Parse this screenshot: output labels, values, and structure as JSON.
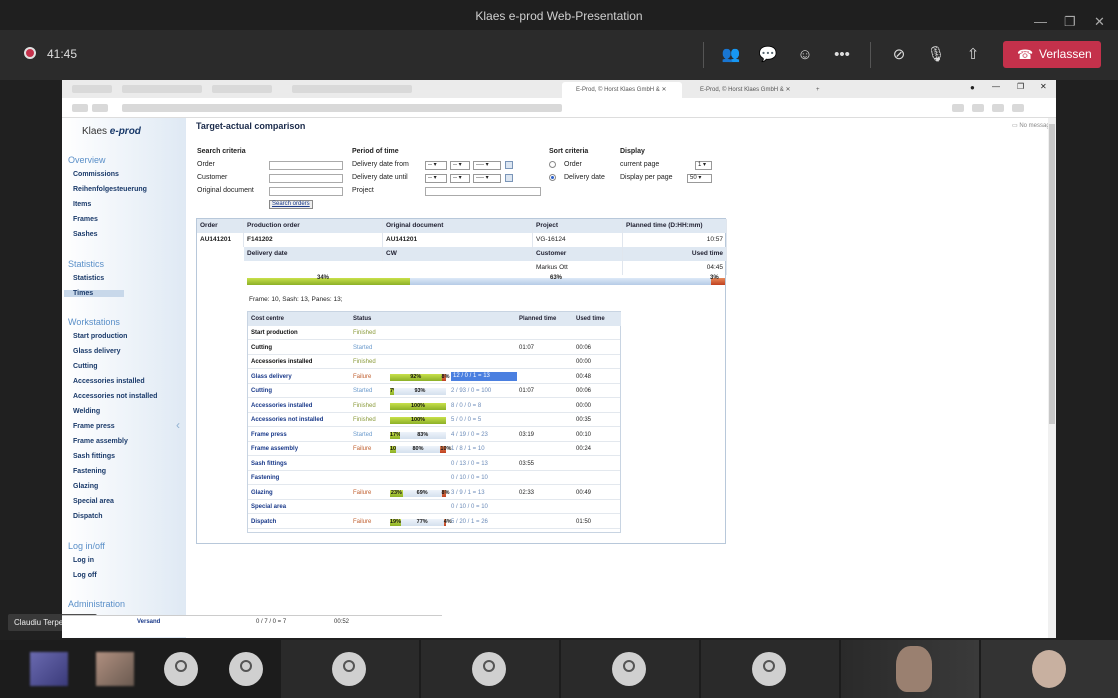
{
  "window": {
    "title": "Klaes e-prod Web-Presentation"
  },
  "meeting": {
    "timer": "41:45",
    "leave_label": "Verlassen",
    "presenter_name": "Claudiu Terpeziceanu"
  },
  "browser": {
    "tabs": [
      "E-Prod, © Horst Klaes GmbH &",
      "E-Prod, © Horst Klaes GmbH &"
    ]
  },
  "sidebar": {
    "logo_text": "Klaes",
    "logo_brand": "e-prod",
    "overview": {
      "title": "Overview",
      "items": [
        "Commissions",
        "Reihenfolgesteuerung",
        "Items",
        "Frames",
        "Sashes"
      ]
    },
    "statistics": {
      "title": "Statistics",
      "items": [
        "Statistics",
        "Times"
      ]
    },
    "workstations": {
      "title": "Workstations",
      "items": [
        "Start production",
        "Glass delivery",
        "Cutting",
        "Accessories installed",
        "Accessories not installed",
        "Welding",
        "Frame press",
        "Frame assembly",
        "Sash fittings",
        "Fastening",
        "Glazing",
        "Special area",
        "Dispatch"
      ]
    },
    "login": {
      "title": "Log in/off",
      "items": [
        "Log in",
        "Log off"
      ]
    },
    "admin": {
      "title": "Administration"
    }
  },
  "page": {
    "title": "Target-actual comparison",
    "messages": "No messages"
  },
  "search": {
    "criteria_title": "Search criteria",
    "order": "Order",
    "customer": "Customer",
    "original_document": "Original document",
    "button": "Search orders",
    "period_title": "Period of time",
    "from": "Delivery date from",
    "until": "Delivery date until",
    "project": "Project",
    "dd": "--",
    "dddd": "----",
    "sort_title": "Sort criteria",
    "sort_order": "Order",
    "sort_delivery": "Delivery date",
    "display_title": "Display",
    "current_page": "current page",
    "per_page": "Display per page",
    "current_page_val": "1",
    "per_page_val": "50"
  },
  "order_info": {
    "headers": [
      "Order",
      "Production order",
      "Original document",
      "Project",
      "Planned time (D:HH:mm)"
    ],
    "order": "AU141201",
    "production_order": "F141202",
    "original_document": "AU141201",
    "project": "VG-16124",
    "planned_time": "10:57",
    "headers2": [
      "Delivery date",
      "CW",
      "Customer",
      "Used time"
    ],
    "customer": "Markus Ott",
    "used_time": "04:45",
    "progress": {
      "green_pct": 34,
      "blue_pct": 63,
      "red_pct": 3,
      "green_label": "34%",
      "blue_label": "63%",
      "red_label": "3%"
    },
    "frame_info": "Frame: 10,  Sash: 13,  Panes: 13;"
  },
  "cost_table": {
    "headers": [
      "Cost centre",
      "Status",
      "Planned time",
      "Used time"
    ],
    "rows": [
      {
        "name": "Start production",
        "status": "Finished",
        "planned": "",
        "used": "",
        "top": true
      },
      {
        "name": "Cutting",
        "status": "Started",
        "planned": "01:07",
        "used": "00:06",
        "top": true
      },
      {
        "name": "Accessories installed",
        "status": "Finished",
        "planned": "",
        "used": "00:00",
        "top": true
      },
      {
        "name": "Glass delivery",
        "status": "Failure",
        "bar": [
          "92%",
          "8%"
        ],
        "bar_vals": [
          92,
          0,
          8
        ],
        "counts": "12 / 0 / 1 = 13",
        "planned": "",
        "used": "00:48"
      },
      {
        "name": "Cutting",
        "status": "Started",
        "bar": [
          "7%",
          "93%"
        ],
        "bar_vals": [
          7,
          93,
          0
        ],
        "counts": "2 / 93 / 0 = 100",
        "planned": "01:07",
        "used": "00:06"
      },
      {
        "name": "Accessories installed",
        "status": "Finished",
        "bar": [
          "100%"
        ],
        "bar_vals": [
          100,
          0,
          0
        ],
        "counts": "8 / 0 / 0 = 8",
        "planned": "",
        "used": "00:00"
      },
      {
        "name": "Accessories not installed",
        "status": "Finished",
        "bar": [
          "100%"
        ],
        "bar_vals": [
          100,
          0,
          0
        ],
        "counts": "5 / 0 / 0 = 5",
        "planned": "",
        "used": "00:35"
      },
      {
        "name": "Frame press",
        "status": "Started",
        "bar": [
          "17%",
          "83%"
        ],
        "bar_vals": [
          17,
          83,
          0
        ],
        "counts": "4 / 19 / 0 = 23",
        "planned": "03:19",
        "used": "00:10"
      },
      {
        "name": "Frame assembly",
        "status": "Failure",
        "bar": [
          "10%",
          "80%",
          "10%"
        ],
        "bar_vals": [
          10,
          80,
          10
        ],
        "counts": "1 / 8 / 1 = 10",
        "planned": "",
        "used": "00:24"
      },
      {
        "name": "Sash fittings",
        "status": "",
        "counts": "0 / 13 / 0 = 13",
        "planned": "03:55",
        "used": ""
      },
      {
        "name": "Fastening",
        "status": "",
        "counts": "0 / 10 / 0 = 10",
        "planned": "",
        "used": ""
      },
      {
        "name": "Glazing",
        "status": "Failure",
        "bar": [
          "23%",
          "69%",
          "8%"
        ],
        "bar_vals": [
          23,
          69,
          8
        ],
        "counts": "3 / 9 / 1 = 13",
        "planned": "02:33",
        "used": "00:49"
      },
      {
        "name": "Special area",
        "status": "",
        "counts": "0 / 10 / 0 = 10",
        "planned": "",
        "used": ""
      },
      {
        "name": "Dispatch",
        "status": "Failure",
        "bar": [
          "19%",
          "77%",
          "4%"
        ],
        "bar_vals": [
          19,
          77,
          4
        ],
        "counts": "5 / 20 / 1 = 26",
        "planned": "",
        "used": "01:50"
      }
    ]
  },
  "behind": {
    "name": "Versand",
    "counts": "0 / 7 / 0 = 7",
    "time": "00:52"
  }
}
